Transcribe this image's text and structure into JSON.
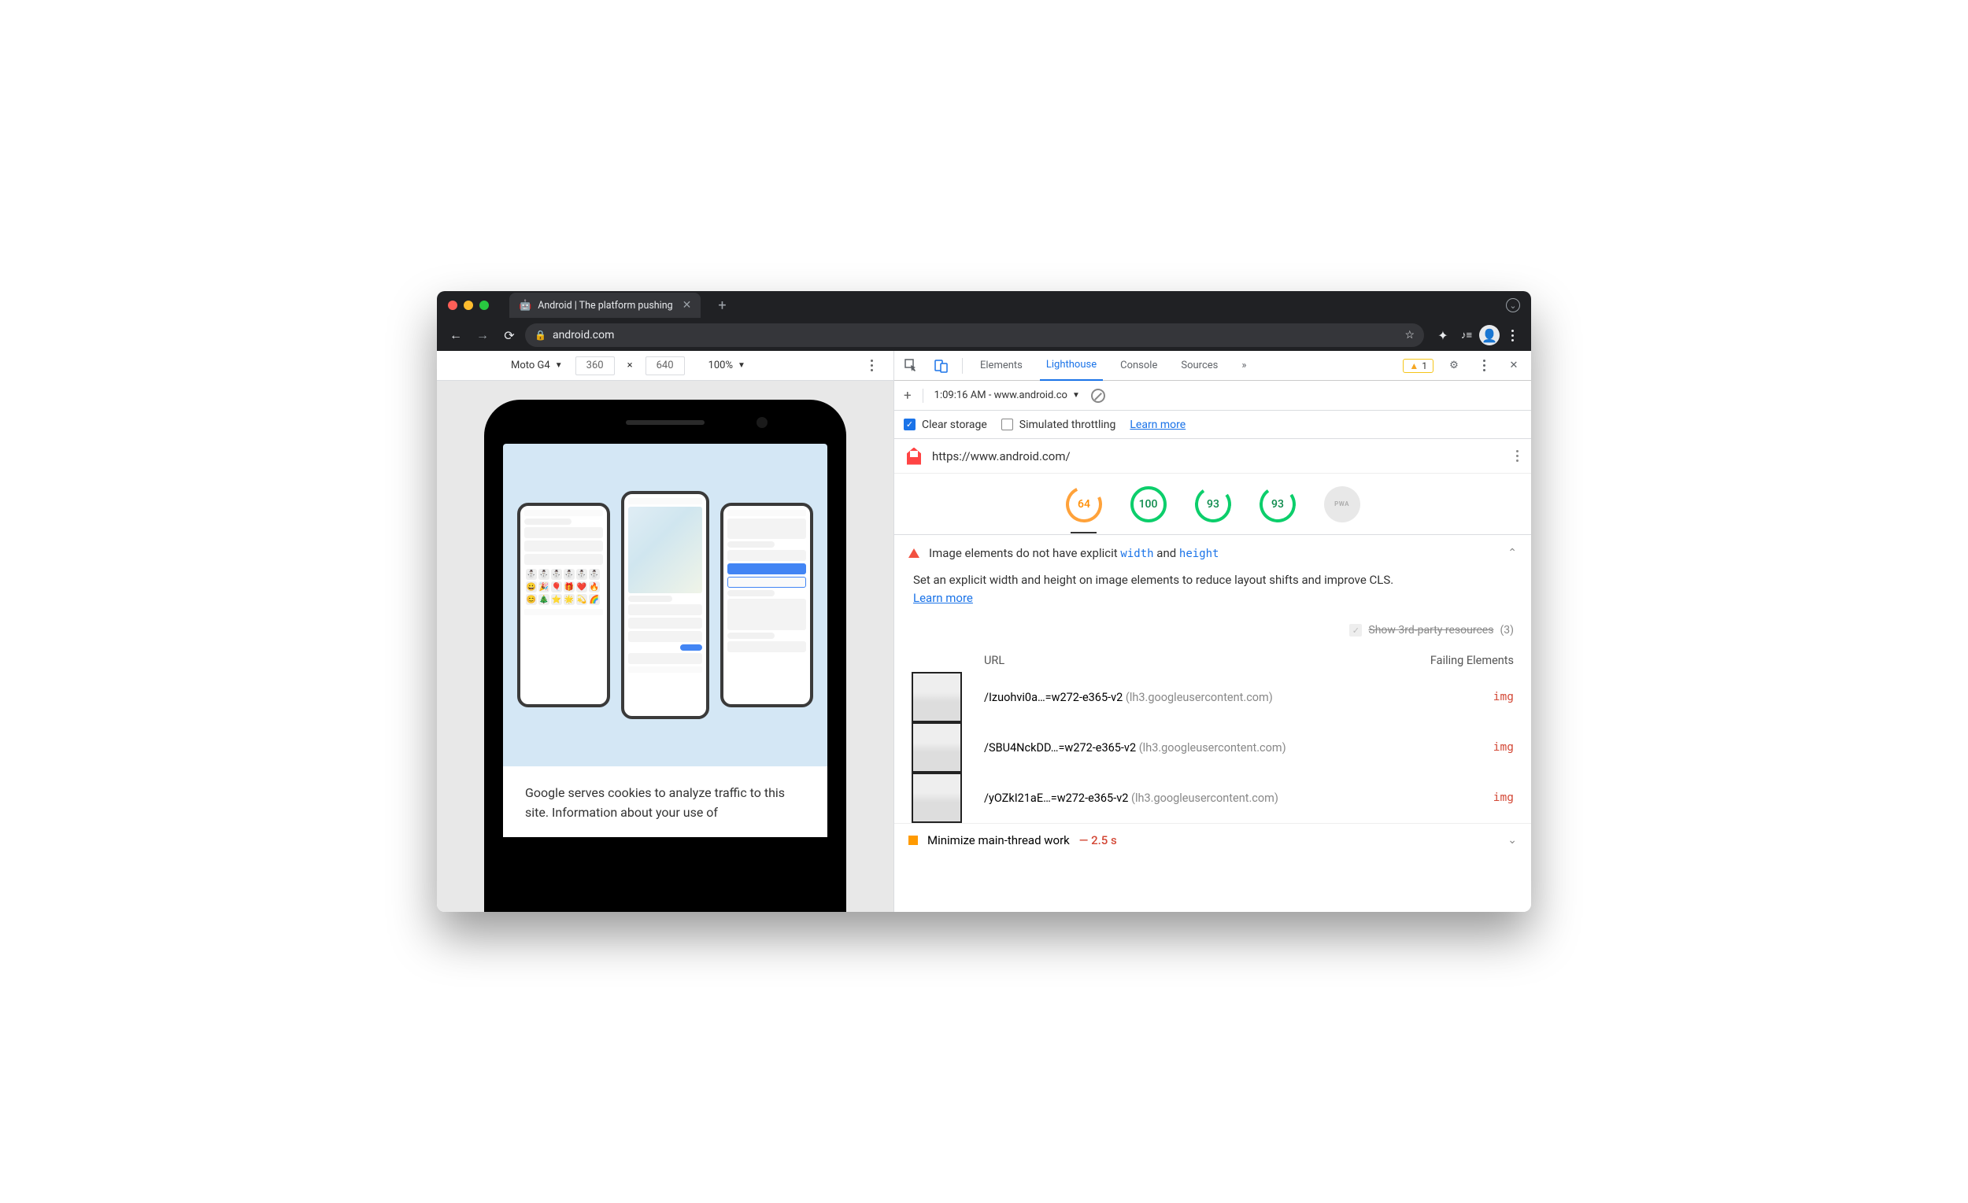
{
  "browser": {
    "tab_title": "Android | The platform pushing",
    "url_display": "android.com"
  },
  "device_toolbar": {
    "device": "Moto G4",
    "width": "360",
    "height": "640",
    "zoom": "100%"
  },
  "cookie_notice": "Google serves cookies to analyze traffic to this site. Information about your use of",
  "devtools": {
    "tabs": [
      "Elements",
      "Lighthouse",
      "Console",
      "Sources"
    ],
    "active_tab": "Lighthouse",
    "warning_count": "1",
    "subbar": {
      "time_url": "1:09:16 AM - www.android.co"
    },
    "options": {
      "clear_storage": "Clear storage",
      "sim_throttling": "Simulated throttling",
      "learn_more": "Learn more"
    },
    "report_url": "https://www.android.com/",
    "scores": {
      "perf": "64",
      "acc": "100",
      "bp": "93",
      "seo": "93",
      "pwa": "PWA"
    }
  },
  "audit": {
    "title_pre": "Image elements do not have explicit ",
    "w": "width",
    "and": " and ",
    "h": "height",
    "desc": "Set an explicit width and height on image elements to reduce layout shifts and improve CLS.",
    "learn_more": "Learn more",
    "third_party_label": "Show 3rd-party resources",
    "third_party_count": "(3)",
    "col_url": "URL",
    "col_fail": "Failing Elements",
    "rows": [
      {
        "path": "/Izuohvi0a…=w272-e365-v2",
        "host": "(lh3.googleusercontent.com)",
        "elem": "img"
      },
      {
        "path": "/SBU4NckDD…=w272-e365-v2",
        "host": "(lh3.googleusercontent.com)",
        "elem": "img"
      },
      {
        "path": "/yOZkI21aE…=w272-e365-v2",
        "host": "(lh3.googleusercontent.com)",
        "elem": "img"
      }
    ]
  },
  "next_audit": {
    "title": "Minimize main-thread work",
    "timing": "— 2.5 s"
  }
}
